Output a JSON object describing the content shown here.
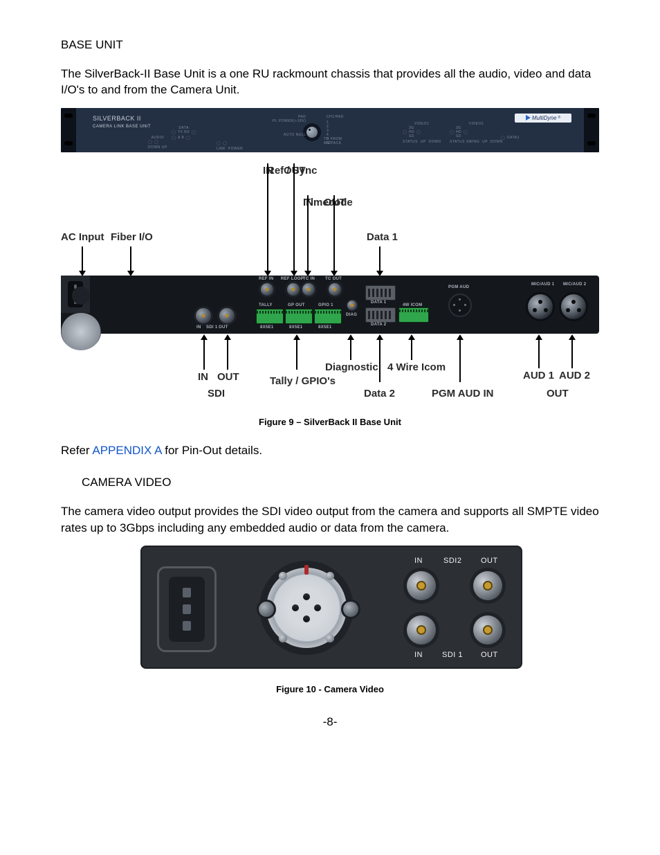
{
  "section_heading": "BASE UNIT",
  "intro_para": "The SilverBack-II Base Unit is a one RU rackmount chassis that provides all the audio, video and data I/O's to and from the Camera Unit.",
  "front_panel": {
    "title": "SILVERBACK II",
    "subtitle": "CAMERA LINK BASE UNIT",
    "brand": "MultiDyne",
    "brand_reg": "®",
    "groups": {
      "data": "DATA",
      "audio": "AUDIO",
      "link": "LINK",
      "power": "POWER",
      "down_up_l": "DOWN    UP",
      "video1": "VIDEO1",
      "video2": "VIDEO2",
      "pad": "PAD",
      "chvpad": "CH1/PAD",
      "plpower": "PL POWER(+18V)",
      "autonull": "AUTO NULL",
      "to_from": "TO    FROM",
      "ms_pack": "MS/PACK",
      "tx_rx": "TX  RX",
      "a_b": "A    B",
      "rates": "3G\nHD\nSD",
      "status1": "STATUS",
      "status2": "STATUS SWING",
      "data_end": "DATA1",
      "nums": "1\n2\n3\n4\n5\nIC"
    }
  },
  "fig9": {
    "caption": "Figure 9 – SilverBack II Base Unit",
    "top": {
      "ref_sync": "Ref / Sync",
      "ref_in": "IN",
      "ref_out": "OUT",
      "timecode": "Timecode",
      "tc_in": "IN",
      "tc_out": "OUT",
      "ac": "AC Input",
      "fiber": "Fiber I/O",
      "data1": "Data 1"
    },
    "bot": {
      "sdi_in": "IN",
      "sdi_out": "OUT",
      "sdi": "SDI",
      "tally": "Tally / GPIO's",
      "diag": "Diagnostic",
      "data2": "Data 2",
      "icom": "4 Wire Icom",
      "pgm": "PGM AUD IN",
      "aud1": "AUD 1",
      "aud2": "AUD 2",
      "out": "OUT"
    },
    "rear_tiny": {
      "ref_in": "REF IN",
      "ref_loop": "REF LOOP",
      "tc_in": "TC IN",
      "tc_out": "TC OUT",
      "sdi_in": "IN",
      "sdi_out": "OUT",
      "sdi1": "SDI 1",
      "data1": "DATA 1",
      "data2": "DATA 2",
      "diag": "DIAG",
      "tally": "TALLY",
      "gpout": "GP OUT",
      "gpio": "GPIO 1",
      "icom": "4W ICOM",
      "pgm": "PGM AUD",
      "mic1": "MIC/AUD 1",
      "mic2": "MIC/AUD 2"
    }
  },
  "refer_line_pre": "Refer ",
  "refer_link": "APPENDIX A",
  "refer_line_post": " for Pin-Out details.",
  "sub_heading": "CAMERA VIDEO",
  "sub_para": "The camera video output provides the SDI video output from the camera and supports all SMPTE video rates up to 3Gbps including any embedded audio or data from the camera.",
  "fig10": {
    "caption": "Figure 10 - Camera Video",
    "in1": "IN",
    "sdi2": "SDI2",
    "out1": "OUT",
    "in2": "IN",
    "sdi1": "SDI 1",
    "out2": "OUT"
  },
  "page_number": "-8-"
}
